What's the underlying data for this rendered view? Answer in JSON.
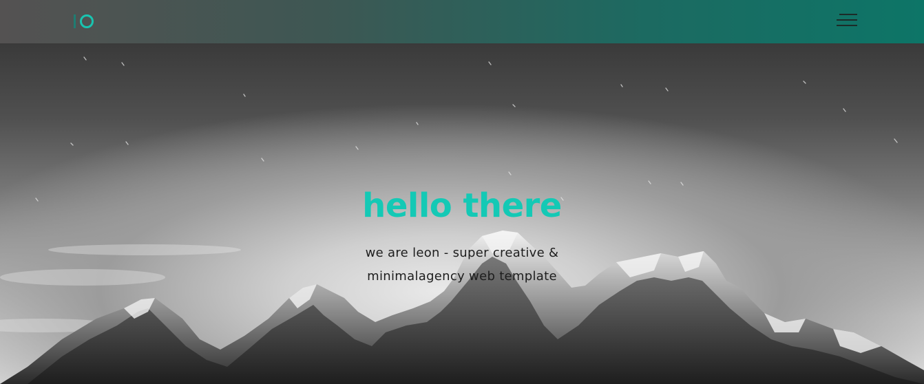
{
  "header": {
    "logo_alt": "IO",
    "menu_icon": "hamburger-menu-icon",
    "accent_color": "#14c9b5"
  },
  "hero": {
    "title": "hello there",
    "subtitle_line1": "we are leon - super creative &",
    "subtitle_line2": "minimalagency web template",
    "background": "mountain-night-sky-image"
  }
}
